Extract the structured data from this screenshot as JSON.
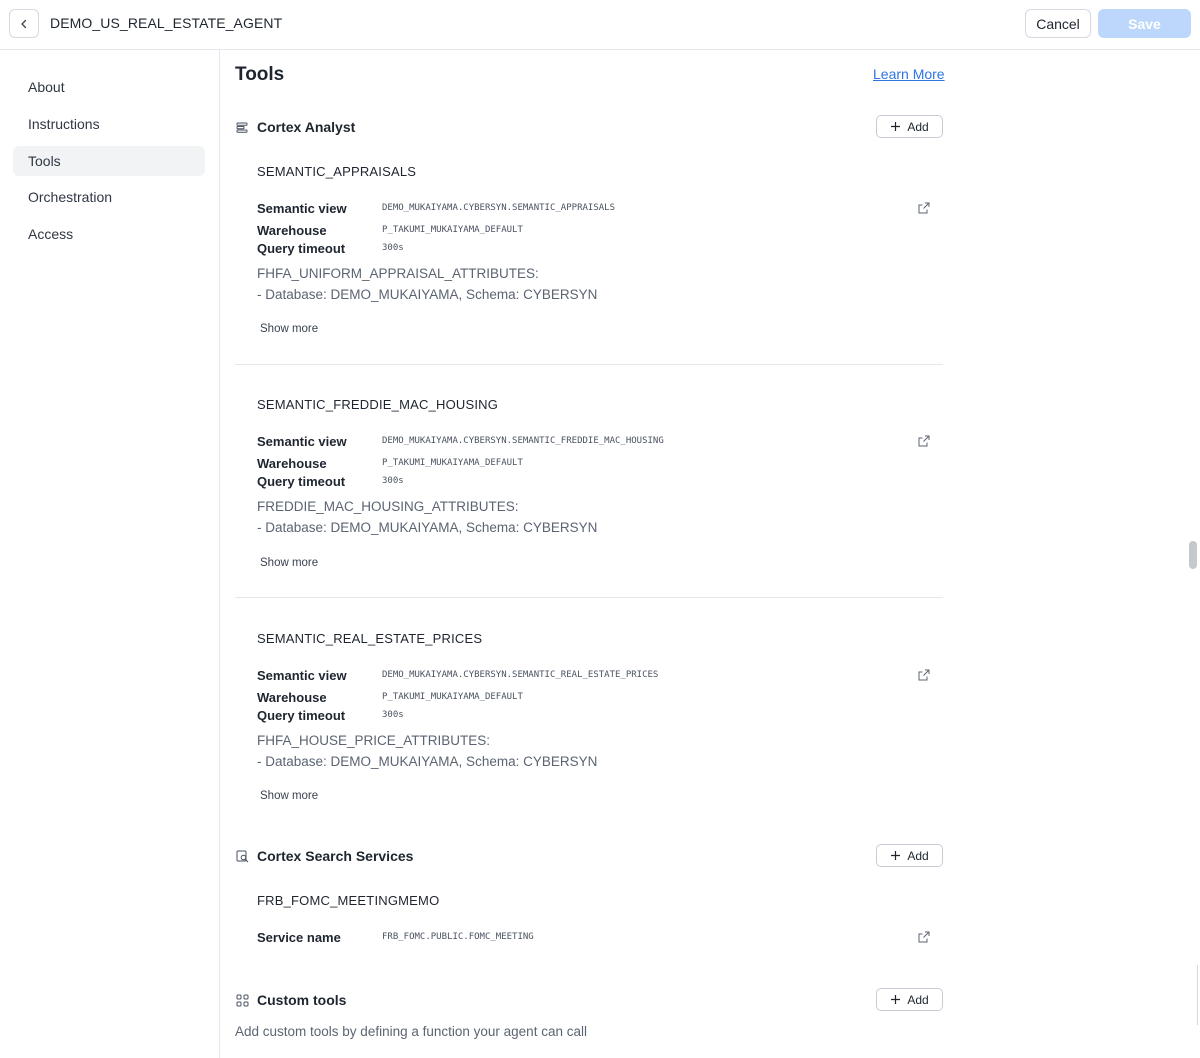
{
  "header": {
    "title": "DEMO_US_REAL_ESTATE_AGENT",
    "cancel_label": "Cancel",
    "save_label": "Save"
  },
  "sidebar": {
    "items": [
      {
        "label": "About"
      },
      {
        "label": "Instructions"
      },
      {
        "label": "Tools"
      },
      {
        "label": "Orchestration"
      },
      {
        "label": "Access"
      }
    ]
  },
  "page": {
    "title": "Tools",
    "learn_more": "Learn More"
  },
  "labels": {
    "semantic_view": "Semantic view",
    "warehouse": "Warehouse",
    "query_timeout": "Query timeout",
    "service_name": "Service name",
    "show_more": "Show more",
    "add": "Add"
  },
  "cortex_analyst": {
    "title": "Cortex Analyst",
    "tools": [
      {
        "name": "SEMANTIC_APPRAISALS",
        "semantic_view": "DEMO_MUKAIYAMA.CYBERSYN.SEMANTIC_APPRAISALS",
        "warehouse": "P_TAKUMI_MUKAIYAMA_DEFAULT",
        "query_timeout": "300s",
        "desc_line1": "FHFA_UNIFORM_APPRAISAL_ATTRIBUTES:",
        "desc_line2": "- Database: DEMO_MUKAIYAMA, Schema: CYBERSYN"
      },
      {
        "name": "SEMANTIC_FREDDIE_MAC_HOUSING",
        "semantic_view": "DEMO_MUKAIYAMA.CYBERSYN.SEMANTIC_FREDDIE_MAC_HOUSING",
        "warehouse": "P_TAKUMI_MUKAIYAMA_DEFAULT",
        "query_timeout": "300s",
        "desc_line1": "FREDDIE_MAC_HOUSING_ATTRIBUTES:",
        "desc_line2": "- Database: DEMO_MUKAIYAMA, Schema: CYBERSYN"
      },
      {
        "name": "SEMANTIC_REAL_ESTATE_PRICES",
        "semantic_view": "DEMO_MUKAIYAMA.CYBERSYN.SEMANTIC_REAL_ESTATE_PRICES",
        "warehouse": "P_TAKUMI_MUKAIYAMA_DEFAULT",
        "query_timeout": "300s",
        "desc_line1": "FHFA_HOUSE_PRICE_ATTRIBUTES:",
        "desc_line2": "- Database: DEMO_MUKAIYAMA, Schema: CYBERSYN"
      }
    ]
  },
  "cortex_search": {
    "title": "Cortex Search Services",
    "tools": [
      {
        "name": "FRB_FOMC_MEETINGMEMO",
        "service_name": "FRB_FOMC.PUBLIC.FOMC_MEETING"
      }
    ]
  },
  "custom_tools": {
    "title": "Custom tools",
    "description": "Add custom tools by defining a function your agent can call"
  },
  "colors": {
    "accent": "#2e75e2",
    "save_disabled": "#bcd7fb",
    "active_nav": "#f1f3f5",
    "border": "#e4e7ec"
  }
}
